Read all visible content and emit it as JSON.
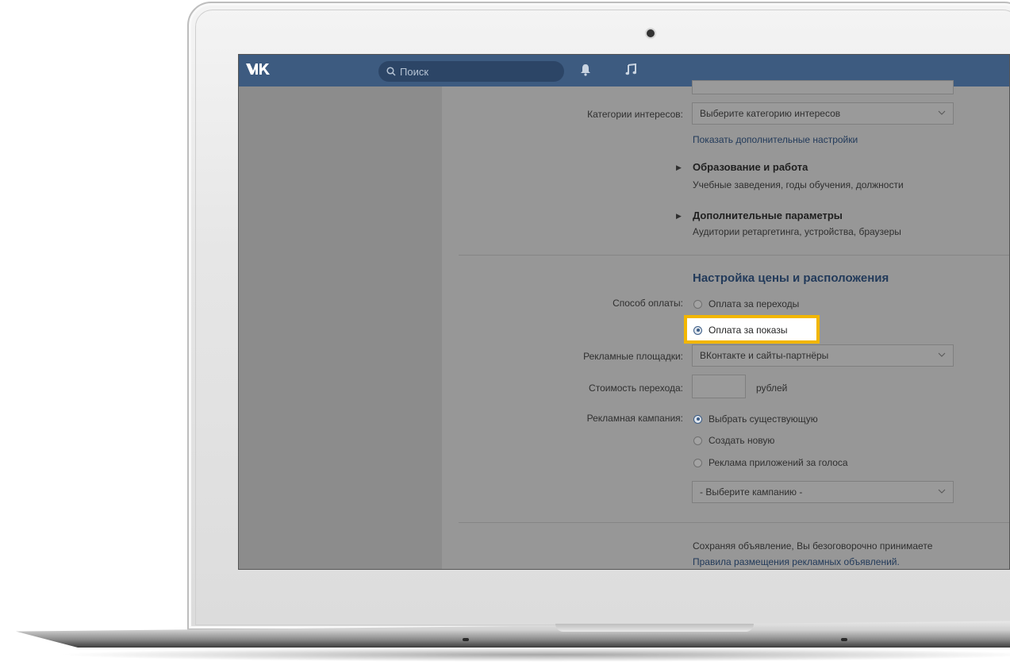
{
  "topbar": {
    "logo_text": "VK",
    "search_placeholder": "Поиск",
    "icons": [
      "search-icon",
      "bell-icon",
      "music-icon"
    ]
  },
  "form": {
    "interests_label": "Категории интересов:",
    "interests_value": "Выберите категорию интересов",
    "show_more_link": "Показать дополнительные настройки",
    "education": {
      "title": "Образование и работа",
      "subtitle": "Учебные заведения, годы обучения, должности"
    },
    "extra": {
      "title": "Дополнительные параметры",
      "subtitle": "Аудитории ретаргетинга, устройства, браузеры"
    },
    "pricing_title": "Настройка цены и расположения",
    "payment_label": "Способ оплаты:",
    "payment_options": [
      "Оплата за переходы",
      "Оплата за показы"
    ],
    "payment_selected": "Оплата за показы",
    "platforms_label": "Рекламные площадки:",
    "platforms_value": "ВКонтакте и сайты-партнёры",
    "cost_label": "Стоимость перехода:",
    "cost_value": "",
    "cost_unit": "рублей",
    "campaign_label": "Рекламная кампания:",
    "campaign_options": [
      "Выбрать существующую",
      "Создать новую",
      "Реклама приложений за голоса"
    ],
    "campaign_selected": "Выбрать существующую",
    "campaign_select_value": "- Выберите кампанию -",
    "terms_text": "Сохраняя объявление, Вы безоговорочно принимаете",
    "terms_link": "Правила размещения рекламных объявлений."
  },
  "colors": {
    "header": "#3d5b80",
    "highlight": "#f2b600",
    "link": "#223a5a"
  }
}
